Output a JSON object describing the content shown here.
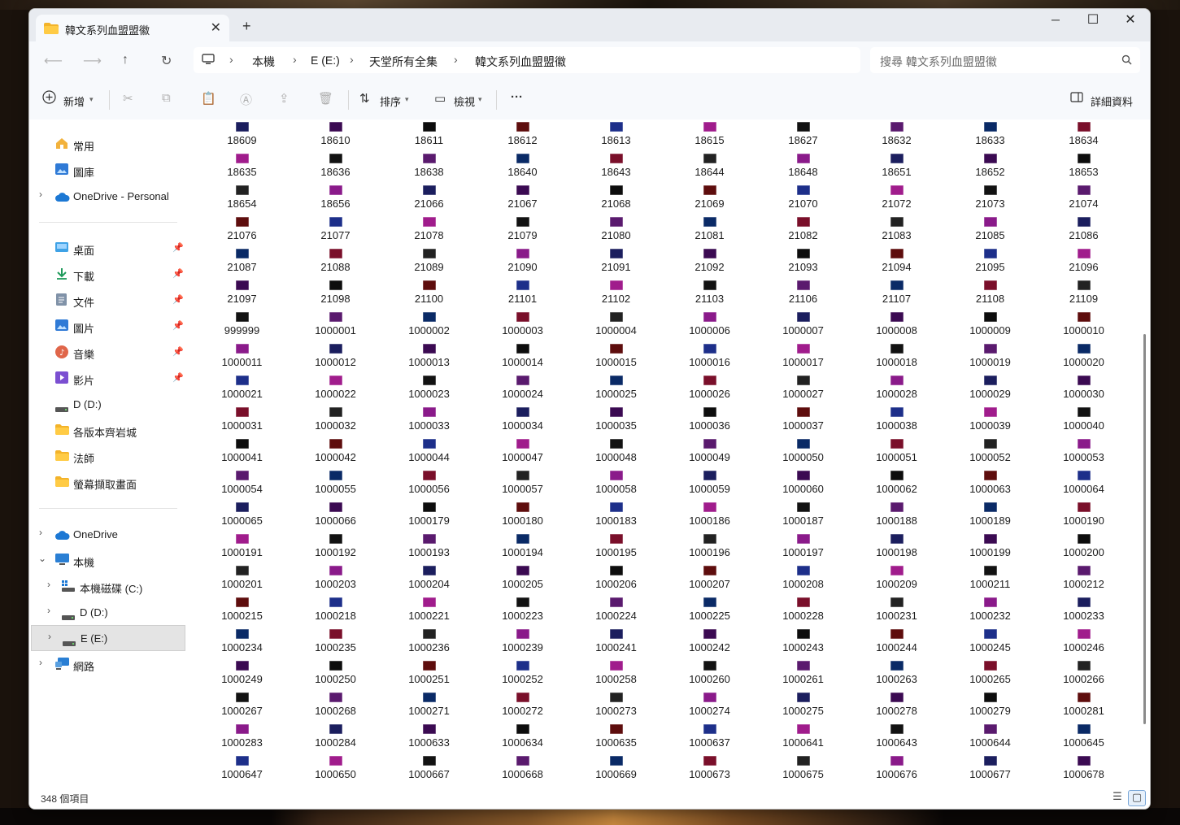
{
  "window": {
    "tab_title": "韓文系列血盟盟徽",
    "new_tab": "+",
    "close_tab": "✕",
    "minimize": "─",
    "maximize": "☐",
    "close": "✕"
  },
  "address": {
    "crumbs": [
      "本機",
      "E (E:)",
      "天堂所有全集",
      "韓文系列血盟盟徽"
    ],
    "search_placeholder": "搜尋 韓文系列血盟盟徽"
  },
  "toolbar": {
    "new_label": "新增",
    "sort_label": "排序",
    "view_label": "檢視",
    "more": "···",
    "details_label": "詳細資料"
  },
  "sidebar": {
    "items": [
      {
        "label": "常用"
      },
      {
        "label": "圖庫"
      },
      {
        "label": "OneDrive - Personal"
      },
      {
        "label": "桌面"
      },
      {
        "label": "下載"
      },
      {
        "label": "文件"
      },
      {
        "label": "圖片"
      },
      {
        "label": "音樂"
      },
      {
        "label": "影片"
      },
      {
        "label": "D (D:)"
      },
      {
        "label": "各版本齊岩城"
      },
      {
        "label": "法師"
      },
      {
        "label": "螢幕擷取畫面"
      },
      {
        "label": "OneDrive"
      },
      {
        "label": "本機"
      },
      {
        "label": "本機磁碟 (C:)"
      },
      {
        "label": "D (D:)"
      },
      {
        "label": "E (E:)"
      },
      {
        "label": "網路"
      }
    ]
  },
  "status": {
    "count": "348 個項目"
  },
  "icon_colors": [
    "#1b1e5e",
    "#5a1a6e",
    "#0d0d0d",
    "#7a0f2a",
    "#1d2f8a",
    "#8a1a8a",
    "#121212",
    "#3b0a52",
    "#0a2a66",
    "#5e0d0d",
    "#222222",
    "#a01c8c"
  ],
  "files": [
    "18609",
    "18610",
    "18611",
    "18612",
    "18613",
    "18615",
    "18627",
    "18632",
    "18633",
    "18634",
    "18635",
    "18636",
    "18638",
    "18640",
    "18643",
    "18644",
    "18648",
    "18651",
    "18652",
    "18653",
    "18654",
    "18656",
    "21066",
    "21067",
    "21068",
    "21069",
    "21070",
    "21072",
    "21073",
    "21074",
    "21076",
    "21077",
    "21078",
    "21079",
    "21080",
    "21081",
    "21082",
    "21083",
    "21085",
    "21086",
    "21087",
    "21088",
    "21089",
    "21090",
    "21091",
    "21092",
    "21093",
    "21094",
    "21095",
    "21096",
    "21097",
    "21098",
    "21100",
    "21101",
    "21102",
    "21103",
    "21106",
    "21107",
    "21108",
    "21109",
    "999999",
    "1000001",
    "1000002",
    "1000003",
    "1000004",
    "1000006",
    "1000007",
    "1000008",
    "1000009",
    "1000010",
    "1000011",
    "1000012",
    "1000013",
    "1000014",
    "1000015",
    "1000016",
    "1000017",
    "1000018",
    "1000019",
    "1000020",
    "1000021",
    "1000022",
    "1000023",
    "1000024",
    "1000025",
    "1000026",
    "1000027",
    "1000028",
    "1000029",
    "1000030",
    "1000031",
    "1000032",
    "1000033",
    "1000034",
    "1000035",
    "1000036",
    "1000037",
    "1000038",
    "1000039",
    "1000040",
    "1000041",
    "1000042",
    "1000044",
    "1000047",
    "1000048",
    "1000049",
    "1000050",
    "1000051",
    "1000052",
    "1000053",
    "1000054",
    "1000055",
    "1000056",
    "1000057",
    "1000058",
    "1000059",
    "1000060",
    "1000062",
    "1000063",
    "1000064",
    "1000065",
    "1000066",
    "1000179",
    "1000180",
    "1000183",
    "1000186",
    "1000187",
    "1000188",
    "1000189",
    "1000190",
    "1000191",
    "1000192",
    "1000193",
    "1000194",
    "1000195",
    "1000196",
    "1000197",
    "1000198",
    "1000199",
    "1000200",
    "1000201",
    "1000203",
    "1000204",
    "1000205",
    "1000206",
    "1000207",
    "1000208",
    "1000209",
    "1000211",
    "1000212",
    "1000215",
    "1000218",
    "1000221",
    "1000223",
    "1000224",
    "1000225",
    "1000228",
    "1000231",
    "1000232",
    "1000233",
    "1000234",
    "1000235",
    "1000236",
    "1000239",
    "1000241",
    "1000242",
    "1000243",
    "1000244",
    "1000245",
    "1000246",
    "1000249",
    "1000250",
    "1000251",
    "1000252",
    "1000258",
    "1000260",
    "1000261",
    "1000263",
    "1000265",
    "1000266",
    "1000267",
    "1000268",
    "1000271",
    "1000272",
    "1000273",
    "1000274",
    "1000275",
    "1000278",
    "1000279",
    "1000281",
    "1000283",
    "1000284",
    "1000633",
    "1000634",
    "1000635",
    "1000637",
    "1000641",
    "1000643",
    "1000644",
    "1000645",
    "1000647",
    "1000650",
    "1000667",
    "1000668",
    "1000669",
    "1000673",
    "1000675",
    "1000676",
    "1000677",
    "1000678"
  ]
}
